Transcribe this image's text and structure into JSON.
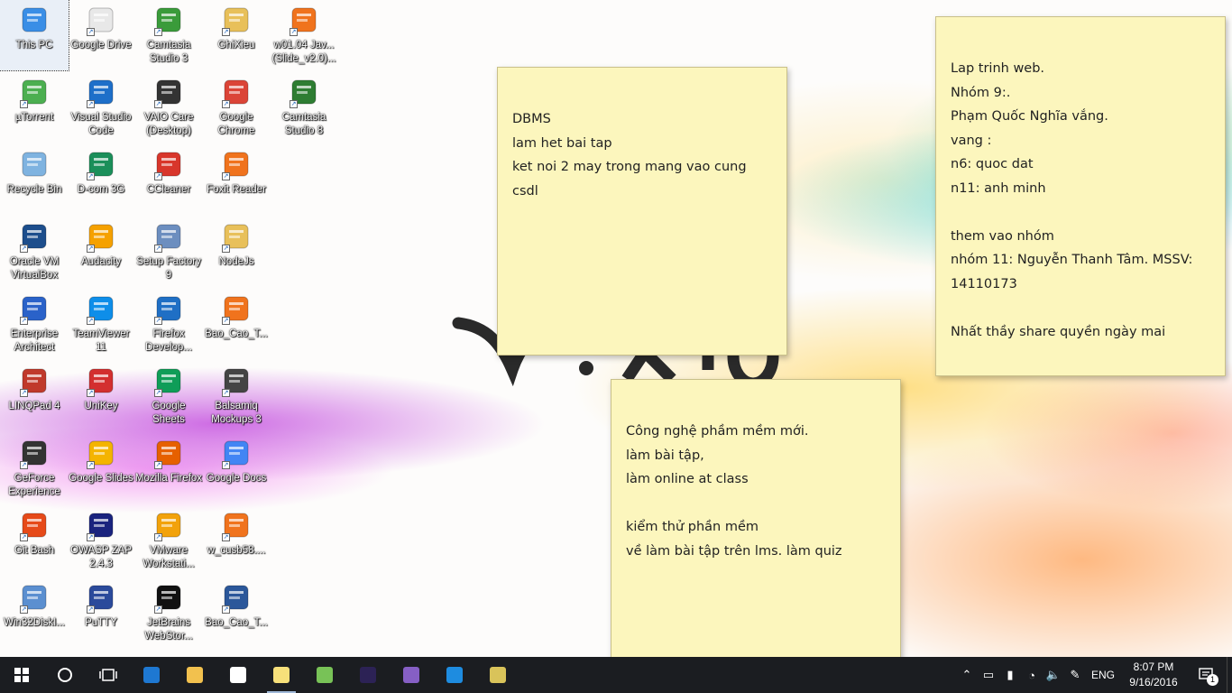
{
  "desktop_icons": [
    {
      "label": "This PC",
      "icon": "computer-icon",
      "color": "#3a8ee6"
    },
    {
      "label": "Google Drive",
      "icon": "document-icon",
      "color": "#e8e8e8"
    },
    {
      "label": "Camtasia Studio 3",
      "icon": "camtasia-icon",
      "color": "#3a9b3a"
    },
    {
      "label": "GhiXieu",
      "icon": "folder-zip-icon",
      "color": "#e8c05a"
    },
    {
      "label": "w01.04 Jav... (Slide_v2.0)...",
      "icon": "pdf-icon",
      "color": "#f0731d"
    },
    {
      "label": "µTorrent",
      "icon": "utorrent-icon",
      "color": "#4caf50"
    },
    {
      "label": "Visual Studio Code",
      "icon": "vscode-icon",
      "color": "#1e6fc9"
    },
    {
      "label": "VAIO Care (Desktop)",
      "icon": "vaio-care-icon",
      "color": "#333333"
    },
    {
      "label": "Google Chrome",
      "icon": "chrome-icon",
      "color": "#db4437"
    },
    {
      "label": "Camtasia Studio 8",
      "icon": "camtasia8-icon",
      "color": "#2e7d32"
    },
    {
      "label": "Recycle Bin",
      "icon": "recycle-bin-icon",
      "color": "#7fb3e0"
    },
    {
      "label": "D-com 3G",
      "icon": "dcom-icon",
      "color": "#1b8f5a"
    },
    {
      "label": "CCleaner",
      "icon": "ccleaner-icon",
      "color": "#d8362b"
    },
    {
      "label": "Foxit Reader",
      "icon": "foxit-icon",
      "color": "#f0731d"
    },
    {
      "label": "Oracle VM VirtualBox",
      "icon": "virtualbox-icon",
      "color": "#1d4e8c"
    },
    {
      "label": "Audacity",
      "icon": "audacity-icon",
      "color": "#f5a100"
    },
    {
      "label": "Setup Factory 9",
      "icon": "setup-factory-icon",
      "color": "#6c8ebf"
    },
    {
      "label": "NodeJs",
      "icon": "nodejs-folder-icon",
      "color": "#e8c05a"
    },
    {
      "label": "Enterprise Architect",
      "icon": "enterprise-architect-icon",
      "color": "#2a62c9"
    },
    {
      "label": "TeamViewer 11",
      "icon": "teamviewer-icon",
      "color": "#0e8ee9"
    },
    {
      "label": "Firefox Develop...",
      "icon": "firefox-dev-icon",
      "color": "#1f6fc5"
    },
    {
      "label": "Bao_Cao_T...",
      "icon": "pdf-icon",
      "color": "#f0731d"
    },
    {
      "label": "LINQPad 4",
      "icon": "linqpad-icon",
      "color": "#c0392b"
    },
    {
      "label": "UniKey",
      "icon": "unikey-icon",
      "color": "#d32f2f"
    },
    {
      "label": "Google Sheets",
      "icon": "sheets-icon",
      "color": "#0f9d58"
    },
    {
      "label": "Balsamiq Mockups 3",
      "icon": "balsamiq-icon",
      "color": "#444444"
    },
    {
      "label": "GeForce Experience",
      "icon": "geforce-icon",
      "color": "#333333"
    },
    {
      "label": "Google Slides",
      "icon": "slides-icon",
      "color": "#f4b400"
    },
    {
      "label": "Mozilla Firefox",
      "icon": "firefox-icon",
      "color": "#e66000"
    },
    {
      "label": "Google Docs",
      "icon": "docs-icon",
      "color": "#4285f4"
    },
    {
      "label": "Git Bash",
      "icon": "git-icon",
      "color": "#e64a19"
    },
    {
      "label": "OWASP ZAP 2.4.3",
      "icon": "zap-icon",
      "color": "#1a237e"
    },
    {
      "label": "VMware Workstati...",
      "icon": "vmware-icon",
      "color": "#f2a20b"
    },
    {
      "label": "w_cusb58....",
      "icon": "pdf-icon",
      "color": "#f0731d"
    },
    {
      "label": "Win32DiskI...",
      "icon": "win32disk-icon",
      "color": "#5b8fd0"
    },
    {
      "label": "PuTTY",
      "icon": "putty-icon",
      "color": "#2b4a9b"
    },
    {
      "label": "JetBrains WebStor...",
      "icon": "webstorm-icon",
      "color": "#111111"
    },
    {
      "label": "Bao_Cao_T...",
      "icon": "word-doc-icon",
      "color": "#2b579a"
    }
  ],
  "notes": [
    {
      "lines": [
        "DBMS",
        "lam het bai tap",
        "ket noi 2 may trong mang vao cung csdl"
      ]
    },
    {
      "lines": [
        "Lap trinh web.",
        "Nhóm 9:.",
        "Phạm Quốc Nghĩa vắng.",
        "vang :",
        "n6: quoc dat",
        "n11: anh minh",
        "",
        "them vao nhóm",
        "nhóm 11: Nguyễn Thanh Tâm. MSSV:",
        "14110173",
        "",
        "Nhất thầy share quyền ngày mai"
      ]
    },
    {
      "lines": [
        "Công nghệ phầm mềm mới.",
        "làm bài tập,",
        "làm online at class",
        "",
        "kiểm thử phần mềm",
        "về làm bài tập trên lms. làm quiz"
      ]
    }
  ],
  "taskbar": {
    "start_icon": "windows-start-icon",
    "apps": [
      {
        "icon": "search-cortana-icon",
        "running": false
      },
      {
        "icon": "task-view-icon",
        "running": false
      },
      {
        "icon": "edge-icon",
        "running": false,
        "color": "#1e78d2"
      },
      {
        "icon": "file-explorer-icon",
        "running": false,
        "color": "#f2c14e"
      },
      {
        "icon": "store-icon",
        "running": false,
        "color": "#ffffff"
      },
      {
        "icon": "sticky-notes-icon",
        "running": true,
        "color": "#f7e07a"
      },
      {
        "icon": "android-studio-icon",
        "running": false,
        "color": "#78c257"
      },
      {
        "icon": "eclipse-icon",
        "running": false,
        "color": "#2c2255"
      },
      {
        "icon": "visual-studio-icon",
        "running": false,
        "color": "#865fc5"
      },
      {
        "icon": "vscode-icon",
        "running": false,
        "color": "#1e8ce0"
      },
      {
        "icon": "tool-app-icon",
        "running": false,
        "color": "#d9c35a"
      }
    ],
    "tray": {
      "language": "ENG",
      "time": "8:07 PM",
      "date": "9/16/2016",
      "notification_count": "1"
    }
  }
}
